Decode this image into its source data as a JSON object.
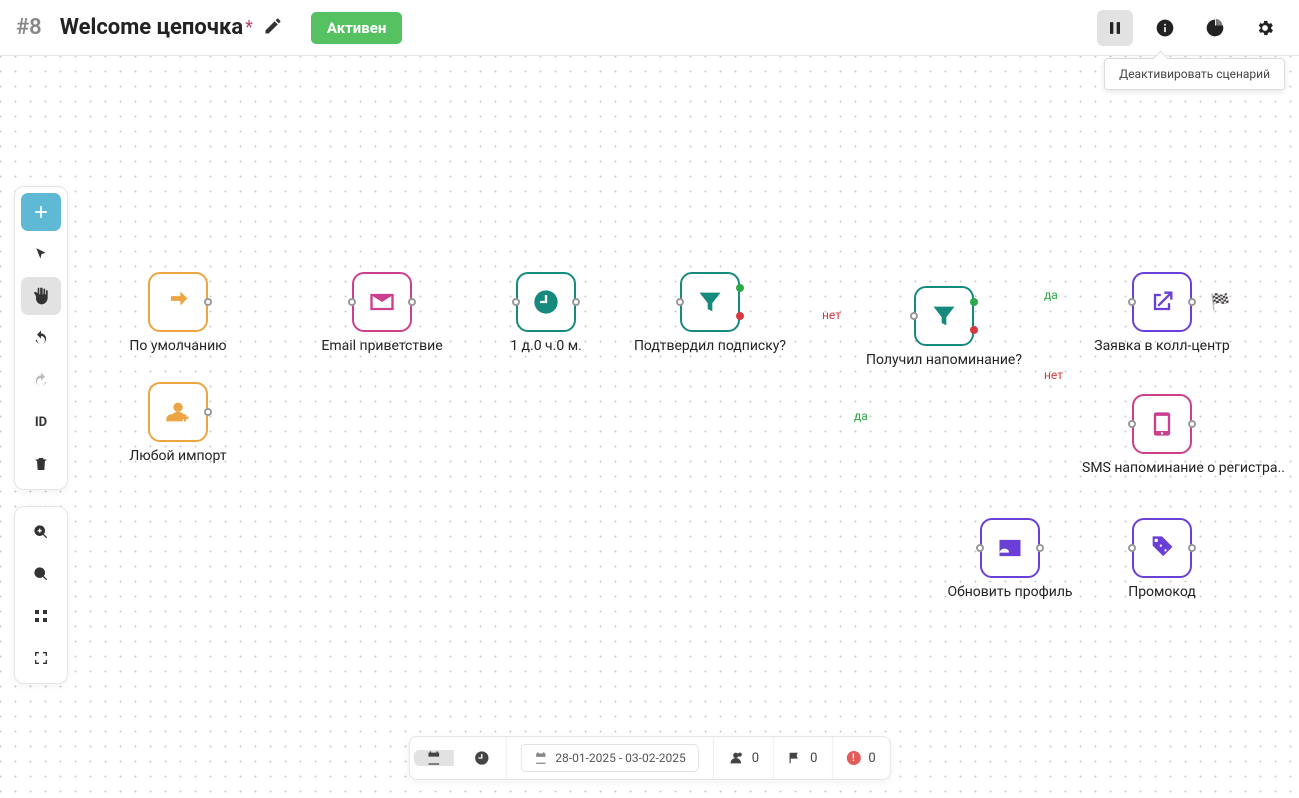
{
  "header": {
    "id": "#8",
    "title": "Welcome цепочка",
    "status": "Активен",
    "tooltip": "Деактивировать сценарий"
  },
  "toolbox": {
    "id_label": "ID"
  },
  "nodes": {
    "default_trigger": "По умолчанию",
    "import_trigger": "Любой импорт",
    "email_welcome": "Email приветствие",
    "delay": "1 д.0 ч.0 м.",
    "confirmed": "Подтвердил подписку?",
    "got_reminder": "Получил напоминание?",
    "callcenter": "Заявка в колл-центр",
    "sms_reminder": "SMS напоминание о регистра..",
    "update_profile": "Обновить профиль",
    "promocode": "Промокод"
  },
  "edges": {
    "yes": "да",
    "no": "нет"
  },
  "footer": {
    "date_range": "28-01-2025 - 03-02-2025",
    "users": "0",
    "flags": "0",
    "errors": "0"
  }
}
